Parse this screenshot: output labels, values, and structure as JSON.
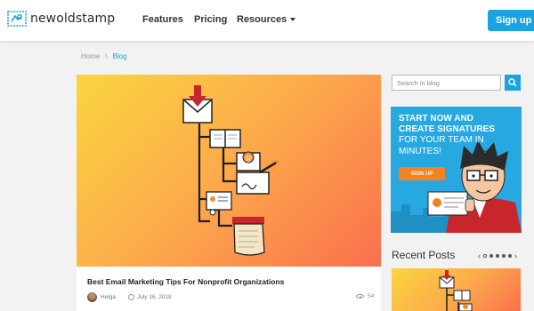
{
  "header": {
    "logo_text": "newoldstamp",
    "nav": [
      {
        "label": "Features"
      },
      {
        "label": "Pricing"
      },
      {
        "label": "Resources"
      }
    ],
    "signup_label": "Sign up"
  },
  "breadcrumb": {
    "home": "Home",
    "separator": "\\",
    "current": "Blog"
  },
  "article": {
    "title": "Best Email Marketing Tips For Nonprofit Organizations",
    "author": "Helga",
    "date": "July 16, 2018",
    "views": "54"
  },
  "sidebar": {
    "search_placeholder": "Search in blog",
    "promo": {
      "line1": "START NOW AND",
      "line2": "CREATE SIGNATURES",
      "line3": "FOR YOUR TEAM IN",
      "line4": "MINUTES!",
      "button": "SIGN UP"
    },
    "recent_title": "Recent Posts",
    "carousel": {
      "prev": "‹",
      "next": "›",
      "dots": 5,
      "active_dot": 1
    }
  },
  "colors": {
    "accent": "#1aa3e0",
    "promo_bg": "#27a8e0",
    "promo_button": "#f58220"
  }
}
